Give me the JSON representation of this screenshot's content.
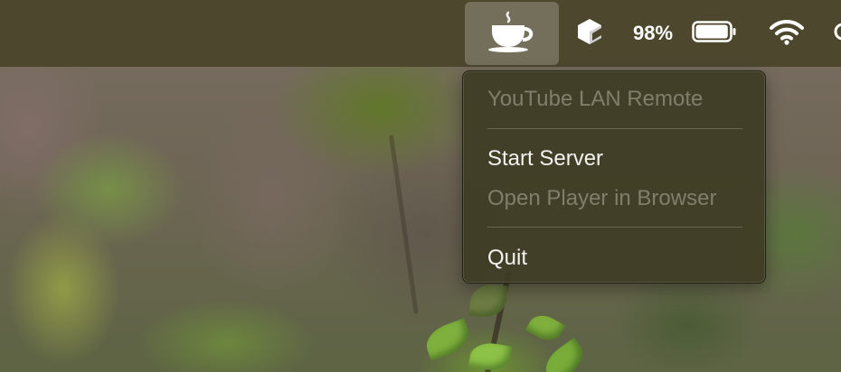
{
  "menubar": {
    "active_app_icon": "coffee-cup-icon",
    "extra_icon": "box-icon",
    "battery_percent": "98%",
    "battery_level": 0.98,
    "wifi_icon": "wifi-icon"
  },
  "menu": {
    "header": "YouTube LAN Remote",
    "items": [
      {
        "label": "Start Server",
        "enabled": true
      },
      {
        "label": "Open Player in Browser",
        "enabled": false
      },
      {
        "label": "Quit",
        "enabled": true
      }
    ]
  },
  "colors": {
    "menubar_bg": "#4c472d",
    "menu_bg": "#3e3c24",
    "text_enabled": "#f2f2ee"
  }
}
